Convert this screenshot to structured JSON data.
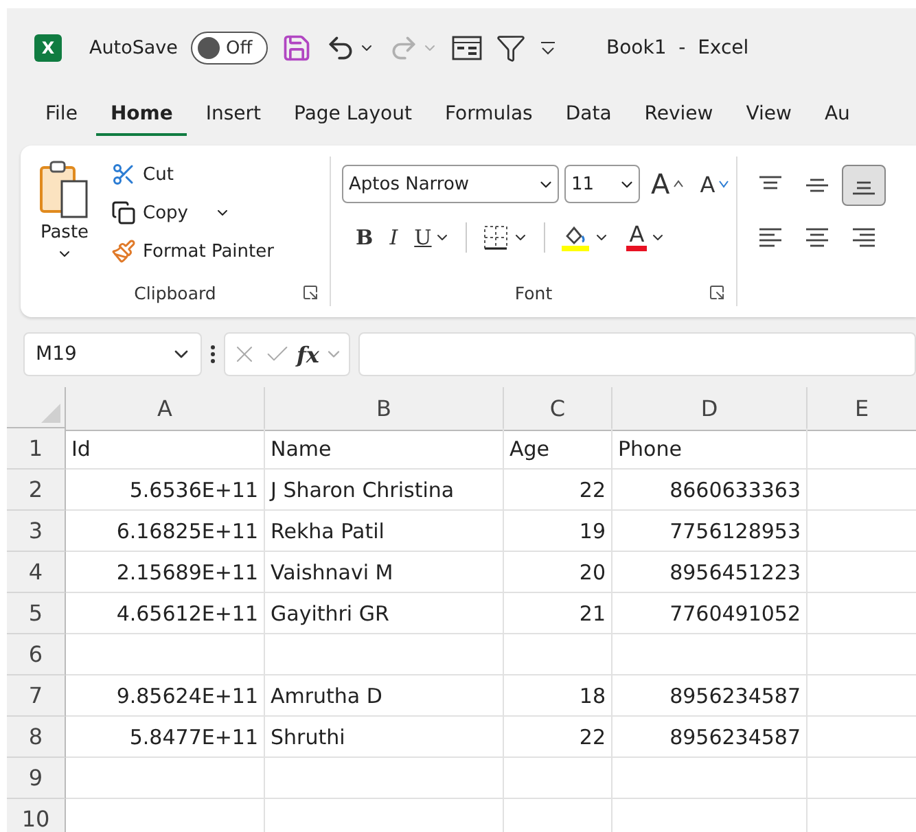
{
  "title_bar": {
    "app_logo": "X",
    "autosave_label": "AutoSave",
    "autosave_toggle": {
      "label": "Off",
      "on": false
    },
    "quick_access": [
      {
        "kind": "save",
        "disabled": false
      },
      {
        "kind": "undo",
        "disabled": false
      },
      {
        "kind": "redo",
        "disabled": true
      },
      {
        "kind": "form",
        "disabled": false
      },
      {
        "kind": "filter",
        "disabled": false
      },
      {
        "kind": "customize",
        "disabled": false
      }
    ],
    "title": "Book1  -  Excel"
  },
  "tabs": [
    {
      "label": "File",
      "selected": false
    },
    {
      "label": "Home",
      "selected": true
    },
    {
      "label": "Insert",
      "selected": false
    },
    {
      "label": "Page Layout",
      "selected": false
    },
    {
      "label": "Formulas",
      "selected": false
    },
    {
      "label": "Data",
      "selected": false
    },
    {
      "label": "Review",
      "selected": false
    },
    {
      "label": "View",
      "selected": false
    },
    {
      "label": "Au",
      "selected": false
    }
  ],
  "ribbon": {
    "clipboard": {
      "paste": "Paste",
      "cut": "Cut",
      "copy": "Copy",
      "format_painter": "Format Painter",
      "label": "Clipboard"
    },
    "font": {
      "font_name": "Aptos Narrow",
      "font_size": "11",
      "grow": "A",
      "shrink": "A",
      "bold": "B",
      "italic": "I",
      "underline": "U",
      "font_color": "A",
      "label": "Font"
    },
    "alignment": {
      "top_row": [
        {
          "kind": "top",
          "selected": false
        },
        {
          "kind": "middle",
          "selected": false
        },
        {
          "kind": "bottom",
          "selected": true
        }
      ],
      "bottom_row": [
        {
          "kind": "left",
          "selected": false
        },
        {
          "kind": "center",
          "selected": false
        },
        {
          "kind": "right",
          "selected": false
        }
      ]
    }
  },
  "formula_bar": {
    "name_box": "M19",
    "function_label": "fx"
  },
  "sheet": {
    "columns": [
      "A",
      "B",
      "C",
      "D",
      "E"
    ],
    "rows": [
      {
        "number": "1",
        "cells": [
          {
            "text": "Id",
            "kind": "text"
          },
          {
            "text": "Name",
            "kind": "text"
          },
          {
            "text": "Age",
            "kind": "text"
          },
          {
            "text": "Phone",
            "kind": "text"
          }
        ]
      },
      {
        "number": "2",
        "cells": [
          {
            "text": "5.6536E+11",
            "kind": "number"
          },
          {
            "text": "J Sharon Christina",
            "kind": "text"
          },
          {
            "text": "22",
            "kind": "number"
          },
          {
            "text": "8660633363",
            "kind": "number"
          }
        ]
      },
      {
        "number": "3",
        "cells": [
          {
            "text": "6.16825E+11",
            "kind": "number"
          },
          {
            "text": "Rekha Patil",
            "kind": "text"
          },
          {
            "text": "19",
            "kind": "number"
          },
          {
            "text": "7756128953",
            "kind": "number"
          }
        ]
      },
      {
        "number": "4",
        "cells": [
          {
            "text": "2.15689E+11",
            "kind": "number"
          },
          {
            "text": "Vaishnavi M",
            "kind": "text"
          },
          {
            "text": "20",
            "kind": "number"
          },
          {
            "text": "8956451223",
            "kind": "number"
          }
        ]
      },
      {
        "number": "5",
        "cells": [
          {
            "text": "4.65612E+11",
            "kind": "number"
          },
          {
            "text": "Gayithri GR",
            "kind": "text"
          },
          {
            "text": "21",
            "kind": "number"
          },
          {
            "text": "7760491052",
            "kind": "number"
          }
        ]
      },
      {
        "number": "6"
      },
      {
        "number": "7",
        "cells": [
          {
            "text": "9.85624E+11",
            "kind": "number"
          },
          {
            "text": "Amrutha D",
            "kind": "text"
          },
          {
            "text": "18",
            "kind": "number"
          },
          {
            "text": "8956234587",
            "kind": "number"
          }
        ]
      },
      {
        "number": "8",
        "cells": [
          {
            "text": "5.8477E+11",
            "kind": "number"
          },
          {
            "text": "Shruthi",
            "kind": "text"
          },
          {
            "text": "22",
            "kind": "number"
          },
          {
            "text": "8956234587",
            "kind": "number"
          }
        ]
      },
      {
        "number": "9"
      },
      {
        "number": "10"
      }
    ]
  }
}
